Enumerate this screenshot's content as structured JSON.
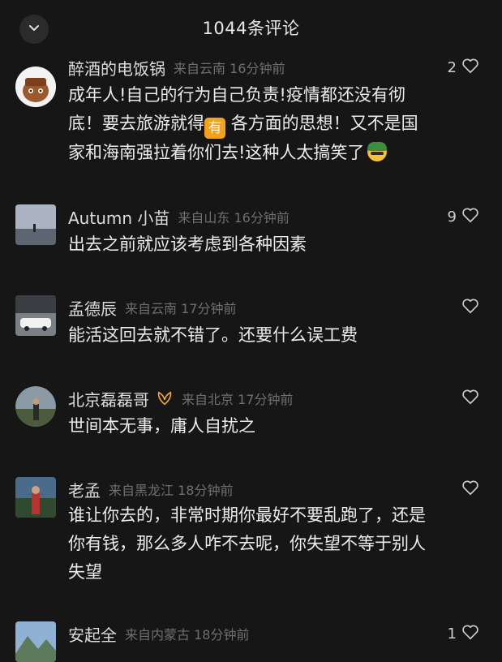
{
  "header": {
    "title": "1044条评论",
    "close_icon": "chevron-down-icon"
  },
  "comments": [
    {
      "name": "醉酒的电饭锅",
      "location": "来自云南 16分钟前",
      "likes": "2",
      "lines": [
        "成年人!自己的行为自己负责!疫情都还没有彻",
        "底！要去旅游就得",
        "各方面的思想！又不是国",
        "家和海南强拉着你们去!这种人太搞笑了"
      ],
      "emoji_box": "有"
    },
    {
      "name": "Autumn 小苗",
      "location": "来自山东 16分钟前",
      "likes": "9",
      "lines": [
        "出去之前就应该考虑到各种因素"
      ]
    },
    {
      "name": "孟德辰",
      "location": "来自云南 17分钟前",
      "likes": "",
      "lines": [
        "能活这回去就不错了。还要什么误工费"
      ]
    },
    {
      "name": "北京磊磊哥",
      "location": "来自北京 17分钟前",
      "likes": "",
      "lines": [
        "世间本无事，庸人自扰之"
      ]
    },
    {
      "name": "老孟",
      "location": "来自黑龙江 18分钟前",
      "likes": "",
      "lines": [
        "谁让你去的，非常时期你最好不要乱跑了，还是",
        "你有钱，那么多人咋不去呢，你失望不等于别人",
        "失望"
      ]
    },
    {
      "name": "安起全",
      "location": "来自内蒙古 18分钟前",
      "likes": "1",
      "lines": []
    }
  ],
  "colors": {
    "background": "#161616",
    "text": "#ececec",
    "muted": "#6f6f6f",
    "badge": "#f4a11d"
  }
}
